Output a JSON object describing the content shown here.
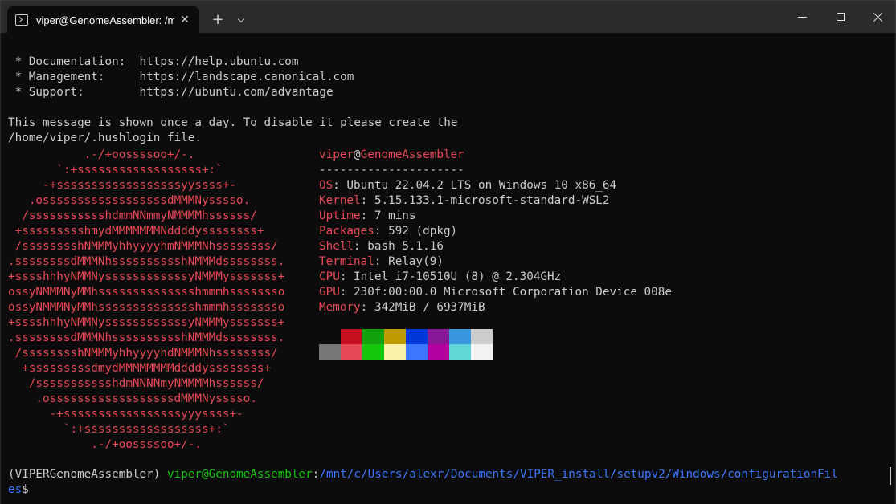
{
  "window": {
    "tab_title": "viper@GenomeAssembler: /mnt",
    "tab_close": "✕",
    "new_tab": "+",
    "tab_icon": "terminal-icon"
  },
  "motd": {
    "doc_line": " * Documentation:  https://help.ubuntu.com",
    "mgmt_line": " * Management:     https://landscape.canonical.com",
    "support_line": " * Support:        https://ubuntu.com/advantage",
    "notice_line1": "This message is shown once a day. To disable it please create the",
    "notice_line2": "/home/viper/.hushlogin file."
  },
  "logo": [
    "           .-/+oossssoo+/-.",
    "       `:+ssssssssssssssssss+:`",
    "     -+ssssssssssssssssssyyssss+-",
    "   .ossssssssssssssssssdMMMNysssso.",
    "  /ssssssssssshdmmNNmmyNMMMMhssssss/",
    " +ssssssssshmydMMMMMMMNddddyssssssss+",
    " /sssssssshNMMMyhhyyyyhmNMMMNhssssssss/",
    ".ssssssssdMMMNhsssssssssshNMMMdssssssss.",
    "+sssshhhyNMMNyssssssssssssyNMMMysssssss+",
    "ossyNMMMNyMMhsssssssssssssshmmmhssssssso",
    "ossyNMMMNyMMhsssssssssssssshmmmhssssssso",
    "+sssshhhyNMMNyssssssssssssyNMMMysssssss+",
    ".ssssssssdMMMNhsssssssssshNMMMdssssssss.",
    " /sssssssshNMMMyhhyyyyhdNMMMNhssssssss/",
    "  +sssssssssdmydMMMMMMMMddddyssssssss+",
    "   /ssssssssssshdmNNNNmyNMMMMhssssss/",
    "    .ossssssssssssssssssdMMMNysssso.",
    "      -+sssssssssssssssssyyyssss+-",
    "        `:+ssssssssssssssssss+:`",
    "            .-/+oossssoo+/-."
  ],
  "info": {
    "user": "viper",
    "at": "@",
    "host": "GenomeAssembler",
    "separator": "---------------------",
    "rows": [
      {
        "key": "OS",
        "value": ": Ubuntu 22.04.2 LTS on Windows 10 x86_64"
      },
      {
        "key": "Kernel",
        "value": ": 5.15.133.1-microsoft-standard-WSL2"
      },
      {
        "key": "Uptime",
        "value": ": 7 mins"
      },
      {
        "key": "Packages",
        "value": ": 592 (dpkg)"
      },
      {
        "key": "Shell",
        "value": ": bash 5.1.16"
      },
      {
        "key": "Terminal",
        "value": ": Relay(9)"
      },
      {
        "key": "CPU",
        "value": ": Intel i7-10510U (8) @ 2.304GHz"
      },
      {
        "key": "GPU",
        "value": ": 230f:00:00.0 Microsoft Corporation Device 008e"
      },
      {
        "key": "Memory",
        "value": ": 342MiB / 6937MiB"
      }
    ]
  },
  "palette": {
    "row1": [
      "#0c0c0c",
      "#c50f1f",
      "#13a10e",
      "#c19c00",
      "#0037da",
      "#881798",
      "#3a96dd",
      "#cccccc"
    ],
    "row2": [
      "#767676",
      "#e74856",
      "#16c60c",
      "#f9f1a5",
      "#3b78ff",
      "#b4009e",
      "#61d6d6",
      "#f2f2f2"
    ]
  },
  "prompt": {
    "env": "(VIPERGenomeAssembler) ",
    "user_host": "viper@GenomeAssembler",
    "colon": ":",
    "path_line1": "/mnt/c/Users/alexr/Documents/VIPER_install/setupv2/Windows/configurationFil",
    "path_line2": "es",
    "dollar": "$"
  }
}
